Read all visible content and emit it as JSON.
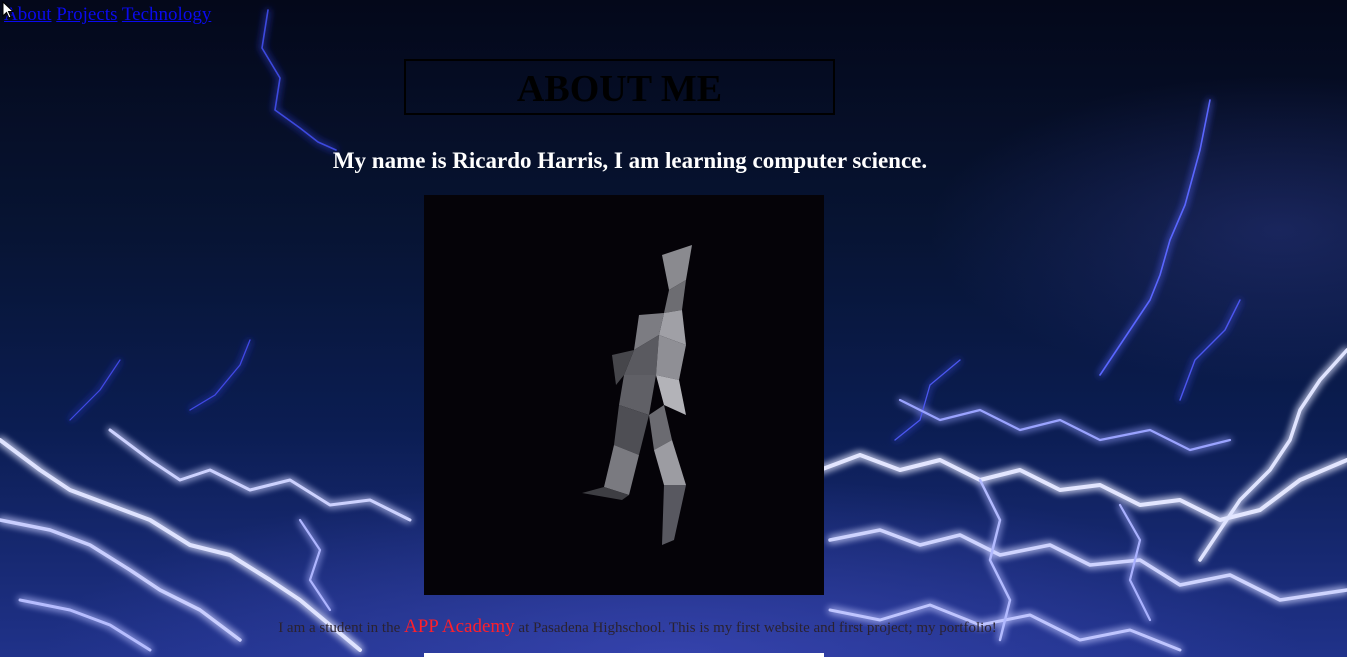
{
  "nav": {
    "links": [
      "About",
      "Projects",
      "Technology"
    ]
  },
  "header": {
    "title": "ABOUT ME"
  },
  "intro": {
    "text": "My name is Ricardo Harris, I am learning computer science."
  },
  "photo": {
    "subject": "low-poly-figure"
  },
  "caption": {
    "before": "I am a student in the ",
    "highlight": "APP Academy",
    "after": " at Pasadena Highschool. This is my first website and first project; my portfolio!"
  },
  "colors": {
    "link": "#0a0aee",
    "highlight": "#ff1f2a",
    "background": "#0b1d52",
    "lightning": "#b9c0ff"
  }
}
